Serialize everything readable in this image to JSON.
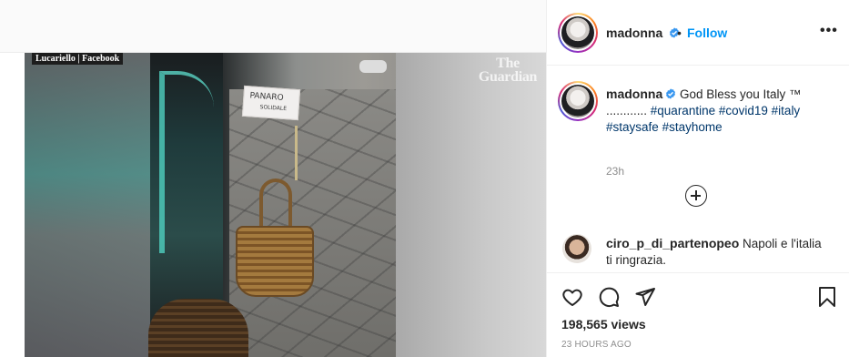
{
  "media": {
    "credit": "Lucariello | Facebook",
    "watermark_line1": "The",
    "watermark_line2": "Guardian",
    "sign_line1": "PANARO",
    "sign_line2": "SOLIDALE"
  },
  "post": {
    "author": "madonna",
    "follow_separator": "•",
    "follow_label": "Follow",
    "more_label": "•••",
    "caption": {
      "text": "God Bless you Italy ™ ............",
      "hashtags": [
        "#quarantine",
        "#covid19",
        "#italy",
        "#staysafe",
        "#stayhome"
      ],
      "time": "23h"
    },
    "comments": [
      {
        "author": "ciro_p_di_partenopeo",
        "text": "Napoli e l'italia ti ringrazia."
      }
    ],
    "views_count": "198,565",
    "views_label": "views",
    "posted_ago": "23 HOURS AGO"
  },
  "colors": {
    "accent": "#0095f6",
    "hashtag": "#00376b",
    "muted": "#8e8e8e",
    "text": "#262626"
  },
  "icons": {
    "verified": "verified-badge-icon",
    "like": "heart-icon",
    "comment": "comment-bubble-icon",
    "share": "paper-plane-icon",
    "save": "bookmark-icon",
    "load_more": "plus-circle-icon",
    "more": "more-options-icon"
  }
}
